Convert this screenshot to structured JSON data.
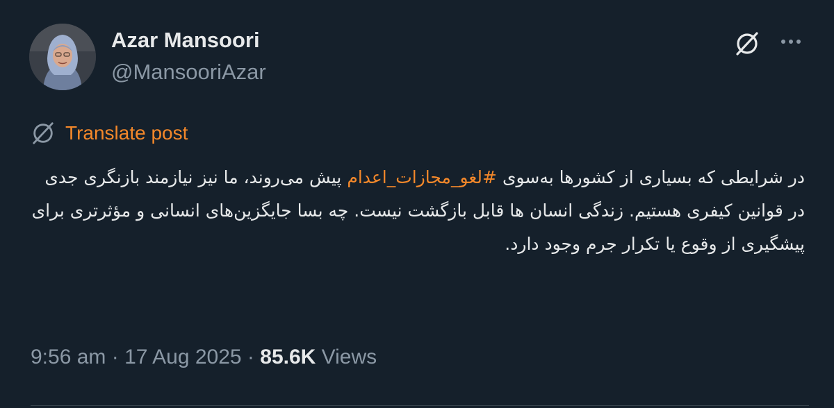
{
  "author": {
    "display_name": "Azar Mansoori",
    "handle": "@MansooriAzar"
  },
  "translate": {
    "label": "Translate post",
    "icon": "grok-icon",
    "accent_color": "#f4882a"
  },
  "post": {
    "text_before_hashtag": "در شرایطی که بسیاری از کشورها به‌سوی ",
    "hashtag": "#لغو_مجازات_اعدام",
    "text_after_hashtag": " پیش می‌روند، ما نیز نیازمند بازنگری جدی در قوانین کیفری هستیم. زندگی انسان ها قابل بازگشت نیست. چه بسا جایگزین‌های انسانی و مؤثرتری برای پیشگیری از وقوع یا تکرار جرم وجود دارد."
  },
  "meta": {
    "time": "9:56 am",
    "separator": " · ",
    "date": "17 Aug 2025",
    "views_count": "85.6K",
    "views_label": " Views"
  },
  "theme": {
    "background": "#15202b",
    "text": "#e7e9ea",
    "secondary": "#8b98a5"
  }
}
